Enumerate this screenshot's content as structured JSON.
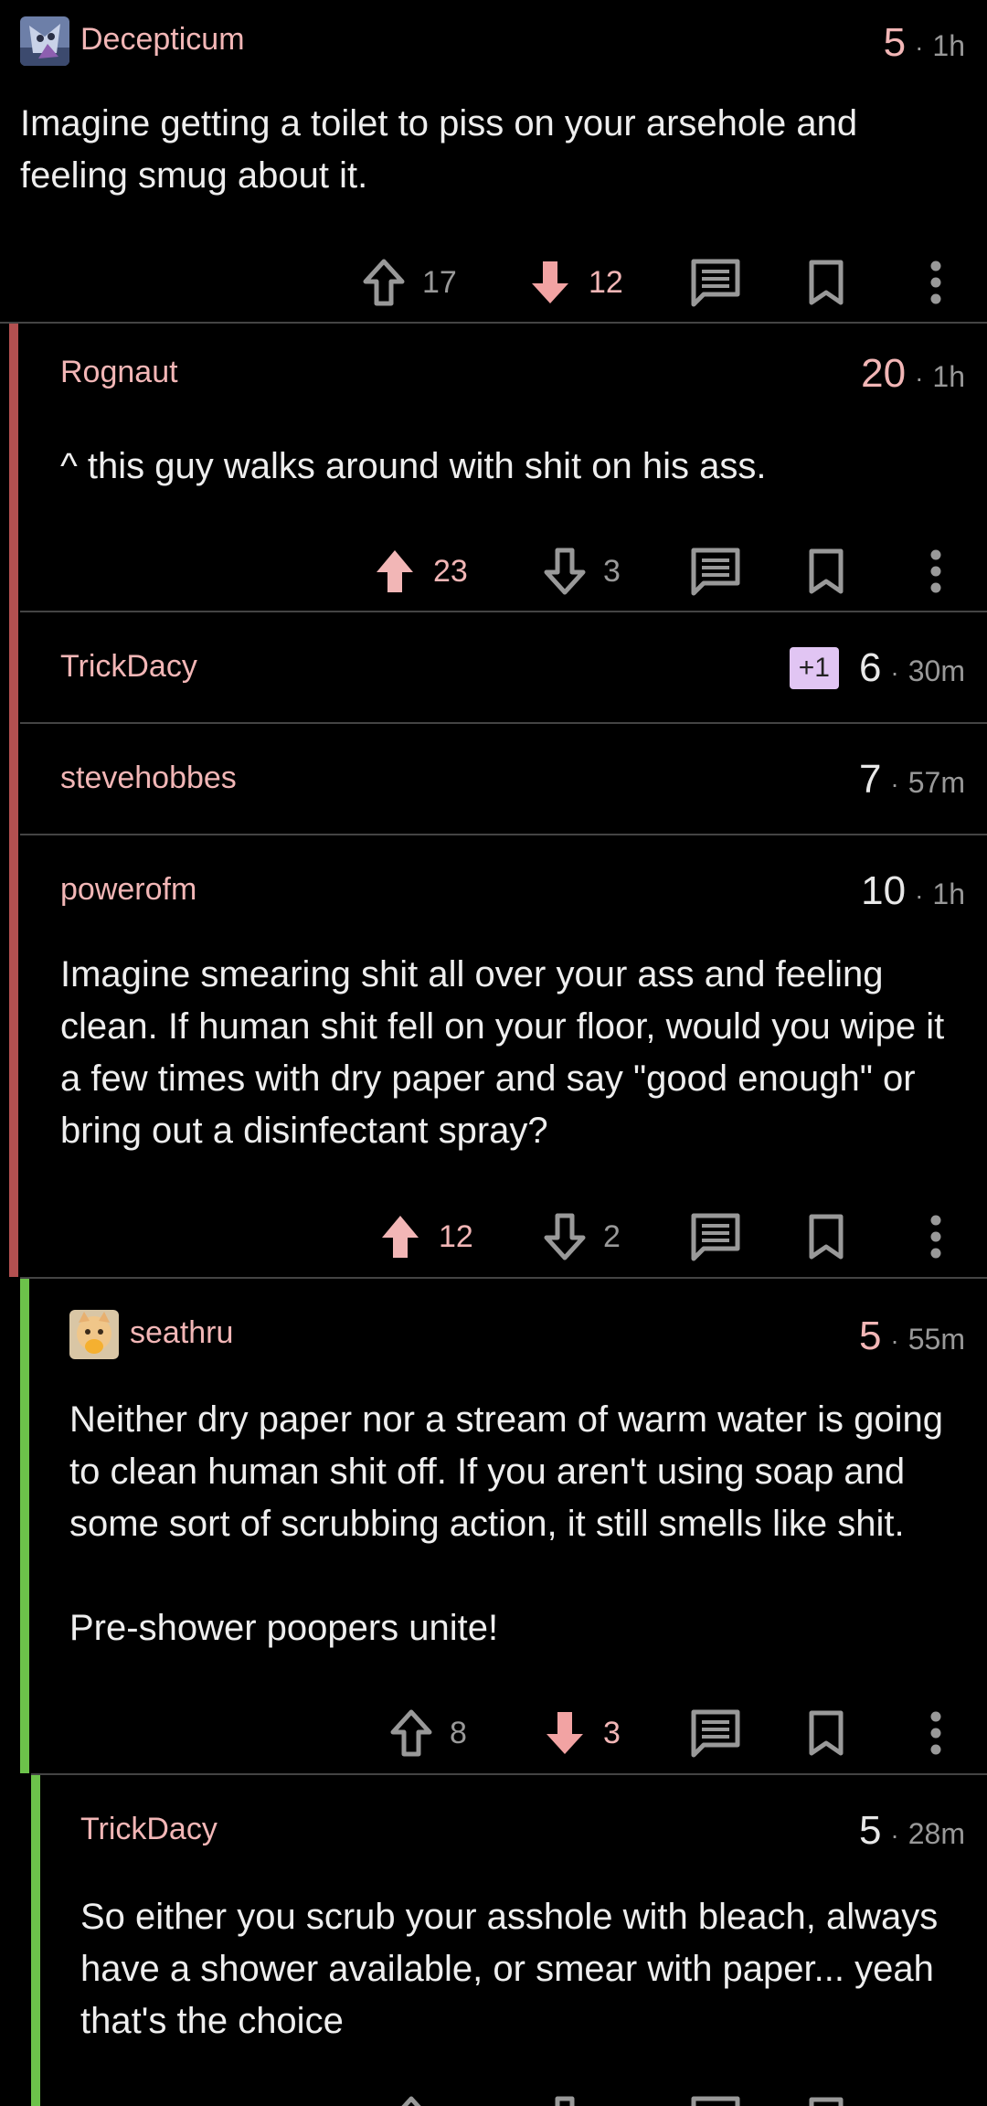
{
  "colors": {
    "accent_pink": "#f2b6b6",
    "rail_red": "#b35050",
    "rail_green": "#6cc24a",
    "badge": "#e1c5f3"
  },
  "comments": [
    {
      "user": "Decepticum",
      "score": "5",
      "time": "1h",
      "body": "Imagine getting a toilet to piss on your arsehole and feeling smug about it.",
      "upvotes": "17",
      "downvotes": "12",
      "vote_state": "downvoted"
    },
    {
      "user": "Rognaut",
      "score": "20",
      "time": "1h",
      "body": "^ this guy walks around with shit on his ass.",
      "upvotes": "23",
      "downvotes": "3",
      "vote_state": "upvoted"
    },
    {
      "user": "TrickDacy",
      "badge": "+1",
      "score": "6",
      "time": "30m",
      "collapsed": true
    },
    {
      "user": "stevehobbes",
      "score": "7",
      "time": "57m",
      "collapsed": true
    },
    {
      "user": "powerofm",
      "score": "10",
      "time": "1h",
      "body": "Imagine smearing shit all over your ass and feeling clean. If human shit fell on your floor, would you wipe it a few times with dry paper and say \"good enough\" or bring out a disinfectant spray?",
      "upvotes": "12",
      "downvotes": "2",
      "vote_state": "upvoted"
    },
    {
      "user": "seathru",
      "score": "5",
      "time": "55m",
      "body_p1": "Neither dry paper nor a stream of warm water is going to clean human shit off. If you aren't using soap and some sort of scrubbing action, it still smells like shit.",
      "body_p2": "Pre-shower poopers unite!",
      "upvotes": "8",
      "downvotes": "3",
      "vote_state": "downvoted"
    },
    {
      "user": "TrickDacy",
      "score": "5",
      "time": "28m",
      "body": "So either you scrub your asshole with bleach, always have a shower available, or smear with paper... yeah that's the choice"
    }
  ],
  "icons": {
    "upvote": "arrow-up-icon",
    "downvote": "arrow-down-icon",
    "reply": "reply-icon",
    "save": "bookmark-icon",
    "more": "more-vertical-icon"
  }
}
